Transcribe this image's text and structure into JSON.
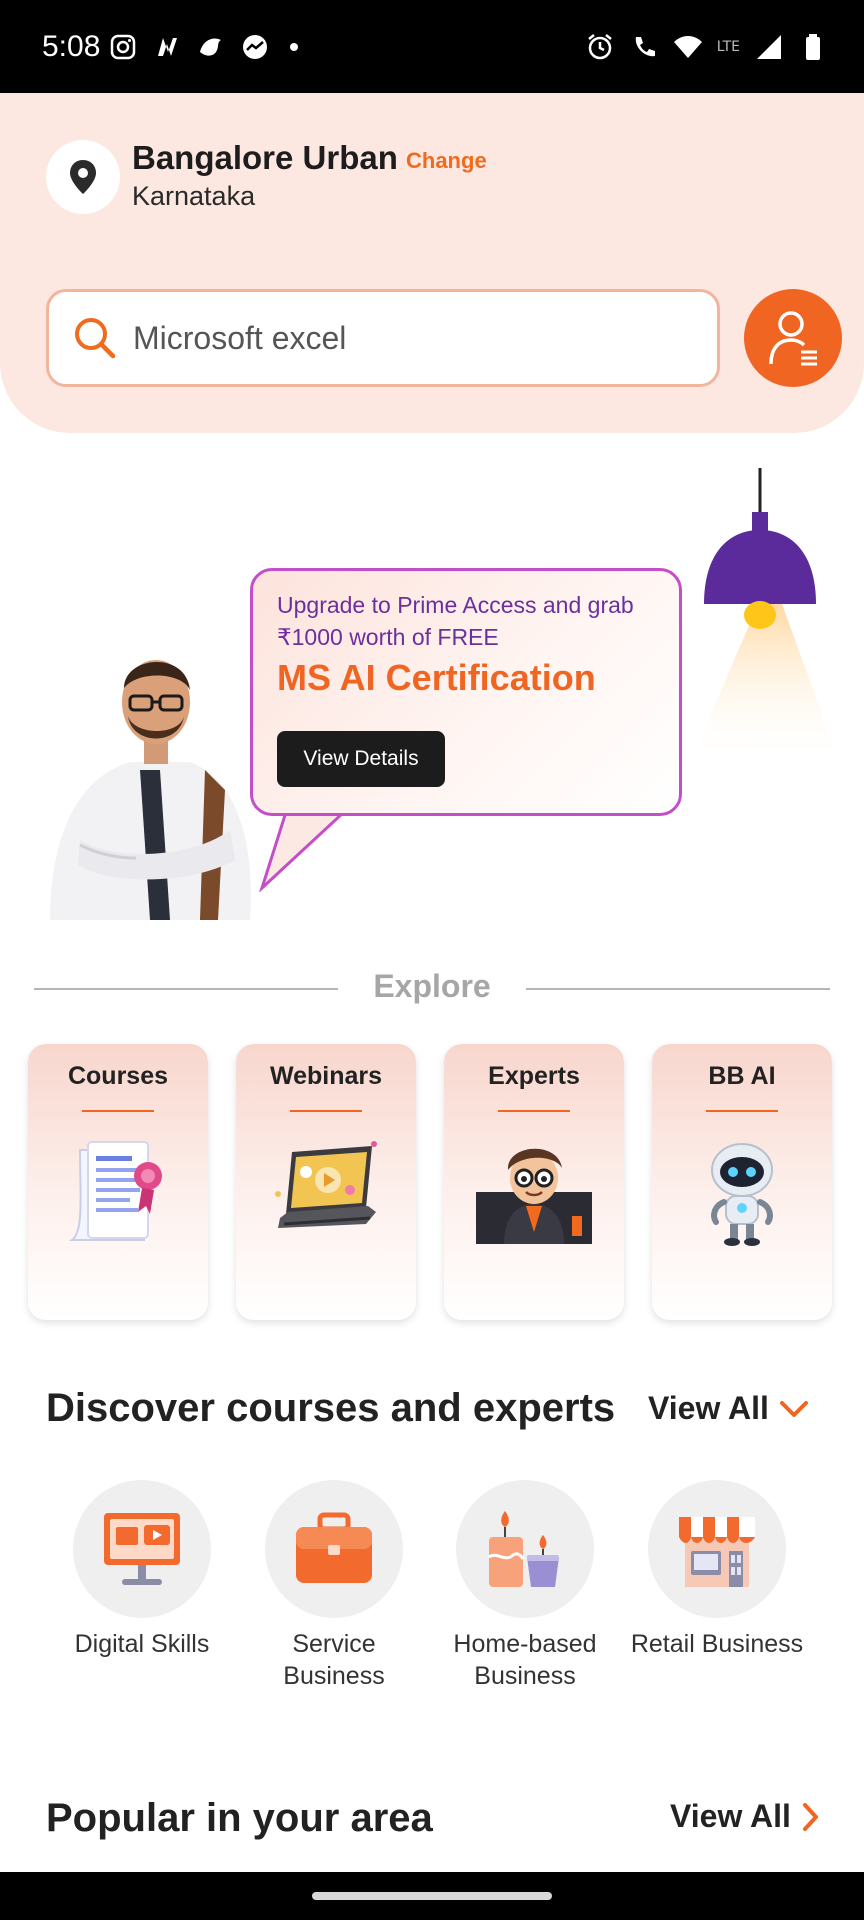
{
  "status_bar": {
    "time": "5:08",
    "network": "LTE"
  },
  "location": {
    "title": "Bangalore Urban",
    "change_label": "Change",
    "subtitle": "Karnataka"
  },
  "search": {
    "value": "Microsoft excel"
  },
  "banner": {
    "line1": "Upgrade to Prime Access and grab ₹1000 worth of FREE",
    "title": "MS AI Certification",
    "button_label": "View Details"
  },
  "explore": {
    "label": "Explore",
    "cards": [
      {
        "label": "Courses",
        "icon": "certificate-icon"
      },
      {
        "label": "Webinars",
        "icon": "laptop-video-icon"
      },
      {
        "label": "Experts",
        "icon": "expert-avatar-icon"
      },
      {
        "label": "BB AI",
        "icon": "robot-icon"
      }
    ]
  },
  "discover": {
    "title": "Discover courses and experts",
    "view_all": "View All",
    "categories": [
      {
        "label": "Digital Skills",
        "icon": "monitor-icon"
      },
      {
        "label": "Service Business",
        "icon": "briefcase-icon"
      },
      {
        "label": "Home-based Business",
        "icon": "candles-icon"
      },
      {
        "label": "Retail Business",
        "icon": "storefront-icon"
      }
    ]
  },
  "popular": {
    "title": "Popular in your area",
    "view_all": "View All"
  },
  "colors": {
    "accent": "#f16522",
    "header_bg": "#fde8e1",
    "bubble_border": "#c44ec9",
    "purple_text": "#6b2f9e"
  }
}
